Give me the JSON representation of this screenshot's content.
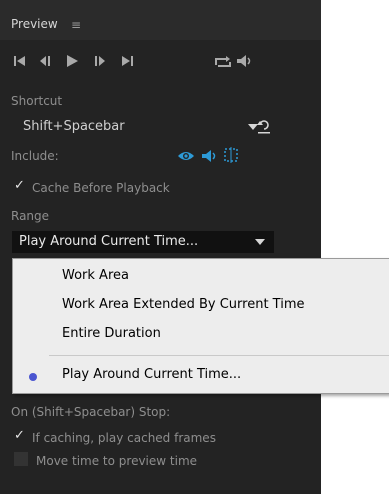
{
  "panel": {
    "title": "Preview",
    "menu_icon": "hamburger-menu-icon"
  },
  "transport": [
    {
      "name": "first-frame-icon"
    },
    {
      "name": "previous-frame-icon"
    },
    {
      "name": "play-icon"
    },
    {
      "name": "next-frame-icon"
    },
    {
      "name": "last-frame-icon"
    },
    {
      "name": "loop-icon"
    },
    {
      "name": "mute-audio-icon"
    }
  ],
  "shortcut": {
    "label": "Shortcut",
    "value": "Shift+Spacebar",
    "reset_icon": "reset-icon"
  },
  "include": {
    "label": "Include:",
    "icons": [
      "eye-icon",
      "audio-icon",
      "overlays-icon"
    ],
    "accent_color": "#2d9ad6"
  },
  "cache": {
    "label": "Cache Before Playback",
    "checked": true
  },
  "range": {
    "label": "Range",
    "value": "Play Around Current Time...",
    "options": [
      "Work Area",
      "Work Area Extended By Current Time",
      "Entire Duration",
      "Play Around Current Time..."
    ],
    "selected_index": 3
  },
  "stop": {
    "label": "On (Shift+Spacebar) Stop:",
    "options": [
      {
        "label": "If caching, play cached frames",
        "checked": true
      },
      {
        "label": "Move time to preview time",
        "checked": false
      }
    ]
  }
}
